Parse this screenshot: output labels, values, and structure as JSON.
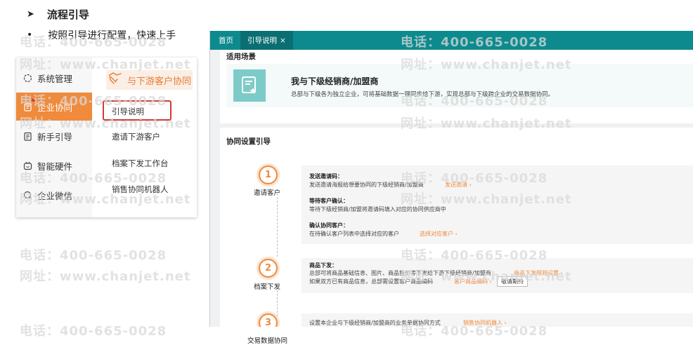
{
  "header": {
    "title_marker": "➤",
    "title": "流程引导",
    "bullet_marker": "•",
    "subtitle": "按照引导进行配置，快速上手"
  },
  "sidebar": {
    "items": [
      {
        "icon": "settings-icon",
        "label": "系统管理"
      },
      {
        "icon": "collab-icon",
        "label": "企业协同"
      },
      {
        "icon": "guide-icon",
        "label": "新手引导"
      },
      {
        "icon": "hardware-icon",
        "label": "智能硬件"
      },
      {
        "icon": "wechat-icon",
        "label": "企业微信"
      }
    ],
    "active_index": 1,
    "submenu": {
      "title": "与下游客户协同",
      "items": [
        "引导说明",
        "邀请下游客户",
        "档案下发工作台",
        "销售协同机器人"
      ],
      "highlighted_index": 0
    }
  },
  "app": {
    "tabs": [
      {
        "label": "首页"
      },
      {
        "label": "引导说明",
        "close": "×"
      }
    ],
    "scene": {
      "section_title": "适用场景",
      "name": "我与下级经销商/加盟商",
      "desc": "总部与下级各为独立企业，可将基础数据一键同步给下游，实现总部与下级跨企业的交易数据协同。"
    },
    "guide": {
      "section_title": "协同设置引导",
      "steps": [
        {
          "num": "1",
          "label": "邀请客户",
          "blocks": [
            {
              "title": "发送邀请码：",
              "desc": "发送邀请海报给想要协同的下级经销商/加盟商",
              "link": "发送邀请 ›"
            },
            {
              "title": "等待客户确认：",
              "desc": "等待下级经销商/加盟将邀请码填入对应的协同供应商中",
              "link": ""
            },
            {
              "title": "确认协同客户：",
              "desc": "在待确认客户列表中选择对应的客户",
              "link": "选择对应客户 ›"
            }
          ]
        },
        {
          "num": "2",
          "label": "档案下发",
          "title": "商品下发：",
          "desc1": "总部可将商品基础信息、图片、商品售价等下发给下游下级经销商/加盟商",
          "link1": "商品下发规则设置 ›",
          "desc2": "如果双方已有商品信息，总部需设置客户商品编码",
          "link2": "客户商品编码 ›",
          "button": "敬请期待"
        },
        {
          "num": "3",
          "label": "交易数据协同",
          "desc": "设置本企业与下级经销商/加盟商的业务单据协同方式",
          "link": "销售协同机器人 ›"
        }
      ]
    }
  },
  "watermark": {
    "phone": "电话：400-665-0028",
    "site": "网址：www.chanjet.net"
  },
  "colors": {
    "accent": "#f08a3c",
    "teal": "#0d8a8e",
    "highlight_box": "#d03c34"
  }
}
